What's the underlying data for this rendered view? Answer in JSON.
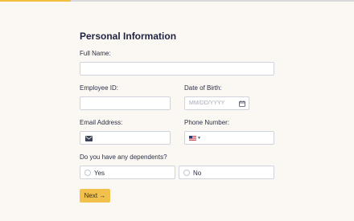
{
  "progress": {
    "fraction": 0.2,
    "color": "#f2bf3c"
  },
  "form": {
    "title": "Personal Information",
    "full_name": {
      "label": "Full Name:",
      "value": ""
    },
    "employee_id": {
      "label": "Employee ID:",
      "value": ""
    },
    "date_of_birth": {
      "label": "Date of Birth:",
      "placeholder": "MM/DD/YYYY",
      "icon": "calendar-icon"
    },
    "email": {
      "label": "Email Address:",
      "value": "",
      "icon": "mail-icon"
    },
    "phone": {
      "label": "Phone Number:",
      "value": "",
      "country_icon": "us-flag-icon"
    },
    "dependents": {
      "question": "Do you have any dependents?",
      "options": [
        {
          "label": "Yes",
          "selected": false
        },
        {
          "label": "No",
          "selected": false
        }
      ]
    },
    "next_label": "Next →"
  }
}
